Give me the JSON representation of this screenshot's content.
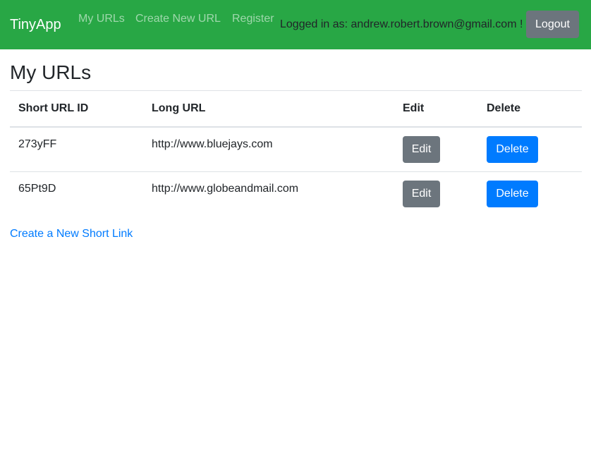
{
  "nav": {
    "brand": "TinyApp",
    "links": [
      "My URLs",
      "Create New URL",
      "Register"
    ],
    "logged_in_text": "Logged in as: andrew.robert.brown@gmail.com !",
    "logout_label": "Logout",
    "bar_color": "#28a745"
  },
  "main": {
    "title": "My URLs",
    "table": {
      "headers": [
        "Short URL ID",
        "Long URL",
        "Edit",
        "Delete"
      ],
      "rows": [
        {
          "short_id": "273yFF",
          "long_url": "http://www.bluejays.com",
          "edit_label": "Edit",
          "delete_label": "Delete"
        },
        {
          "short_id": "65Pt9D",
          "long_url": "http://www.globeandmail.com",
          "edit_label": "Edit",
          "delete_label": "Delete"
        }
      ]
    },
    "create_link": "Create a New Short Link"
  }
}
